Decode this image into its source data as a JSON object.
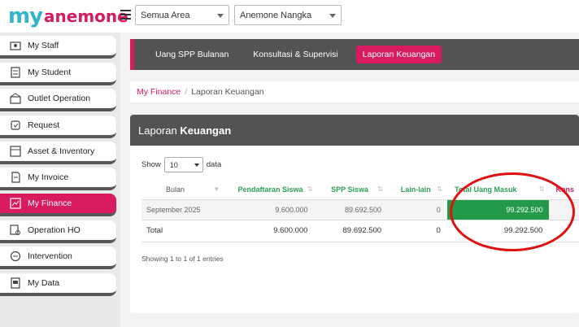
{
  "app": {
    "logo_my": "my",
    "logo_name": "anemone"
  },
  "header": {
    "area_select": "Semua Area",
    "branch_select": "Anemone Nangka"
  },
  "sidebar": {
    "items": [
      {
        "label": "My Staff",
        "icon": "staff-icon"
      },
      {
        "label": "My Student",
        "icon": "student-icon"
      },
      {
        "label": "Outlet Operation",
        "icon": "outlet-icon"
      },
      {
        "label": "Request",
        "icon": "request-icon"
      },
      {
        "label": "Asset & Inventory",
        "icon": "inventory-icon"
      },
      {
        "label": "My Invoice",
        "icon": "invoice-icon"
      },
      {
        "label": "My Finance",
        "icon": "finance-icon",
        "active": true
      },
      {
        "label": "Operation HO",
        "icon": "operation-icon"
      },
      {
        "label": "Intervention",
        "icon": "intervention-icon"
      },
      {
        "label": "My Data",
        "icon": "data-icon"
      }
    ]
  },
  "tabs": [
    {
      "label": "Uang SPP Bulanan"
    },
    {
      "label": "Konsultasi & Supervisi"
    },
    {
      "label": "Laporan Keuangan",
      "active": true
    }
  ],
  "breadcrumb": {
    "parent": "My Finance",
    "separator": "/",
    "current": "Laporan Keuangan"
  },
  "card": {
    "title_light": "Laporan ",
    "title_bold": "Keuangan",
    "show_label": "Show",
    "show_value": "10",
    "data_label": "data",
    "entries_text": "Showing 1 to 1 of 1 entries"
  },
  "table": {
    "headers": [
      "Bulan",
      "Pendaftaran Siswa",
      "SPP Siswa",
      "Lain-lain",
      "Total Uang Masuk",
      "Kons"
    ],
    "rows": [
      {
        "bulan": "September 2025",
        "pendaftaran": "9.600.000",
        "spp": "89.692.500",
        "lain": "0",
        "total": "99.292.500"
      }
    ],
    "total": {
      "label": "Total",
      "pendaftaran": "9.600.000",
      "spp": "89.692.500",
      "lain": "0",
      "total": "99.292.500"
    }
  },
  "colors": {
    "accent": "#d81b60",
    "header_bg": "#535353",
    "green": "#23994a",
    "annotation": "#e01010"
  }
}
